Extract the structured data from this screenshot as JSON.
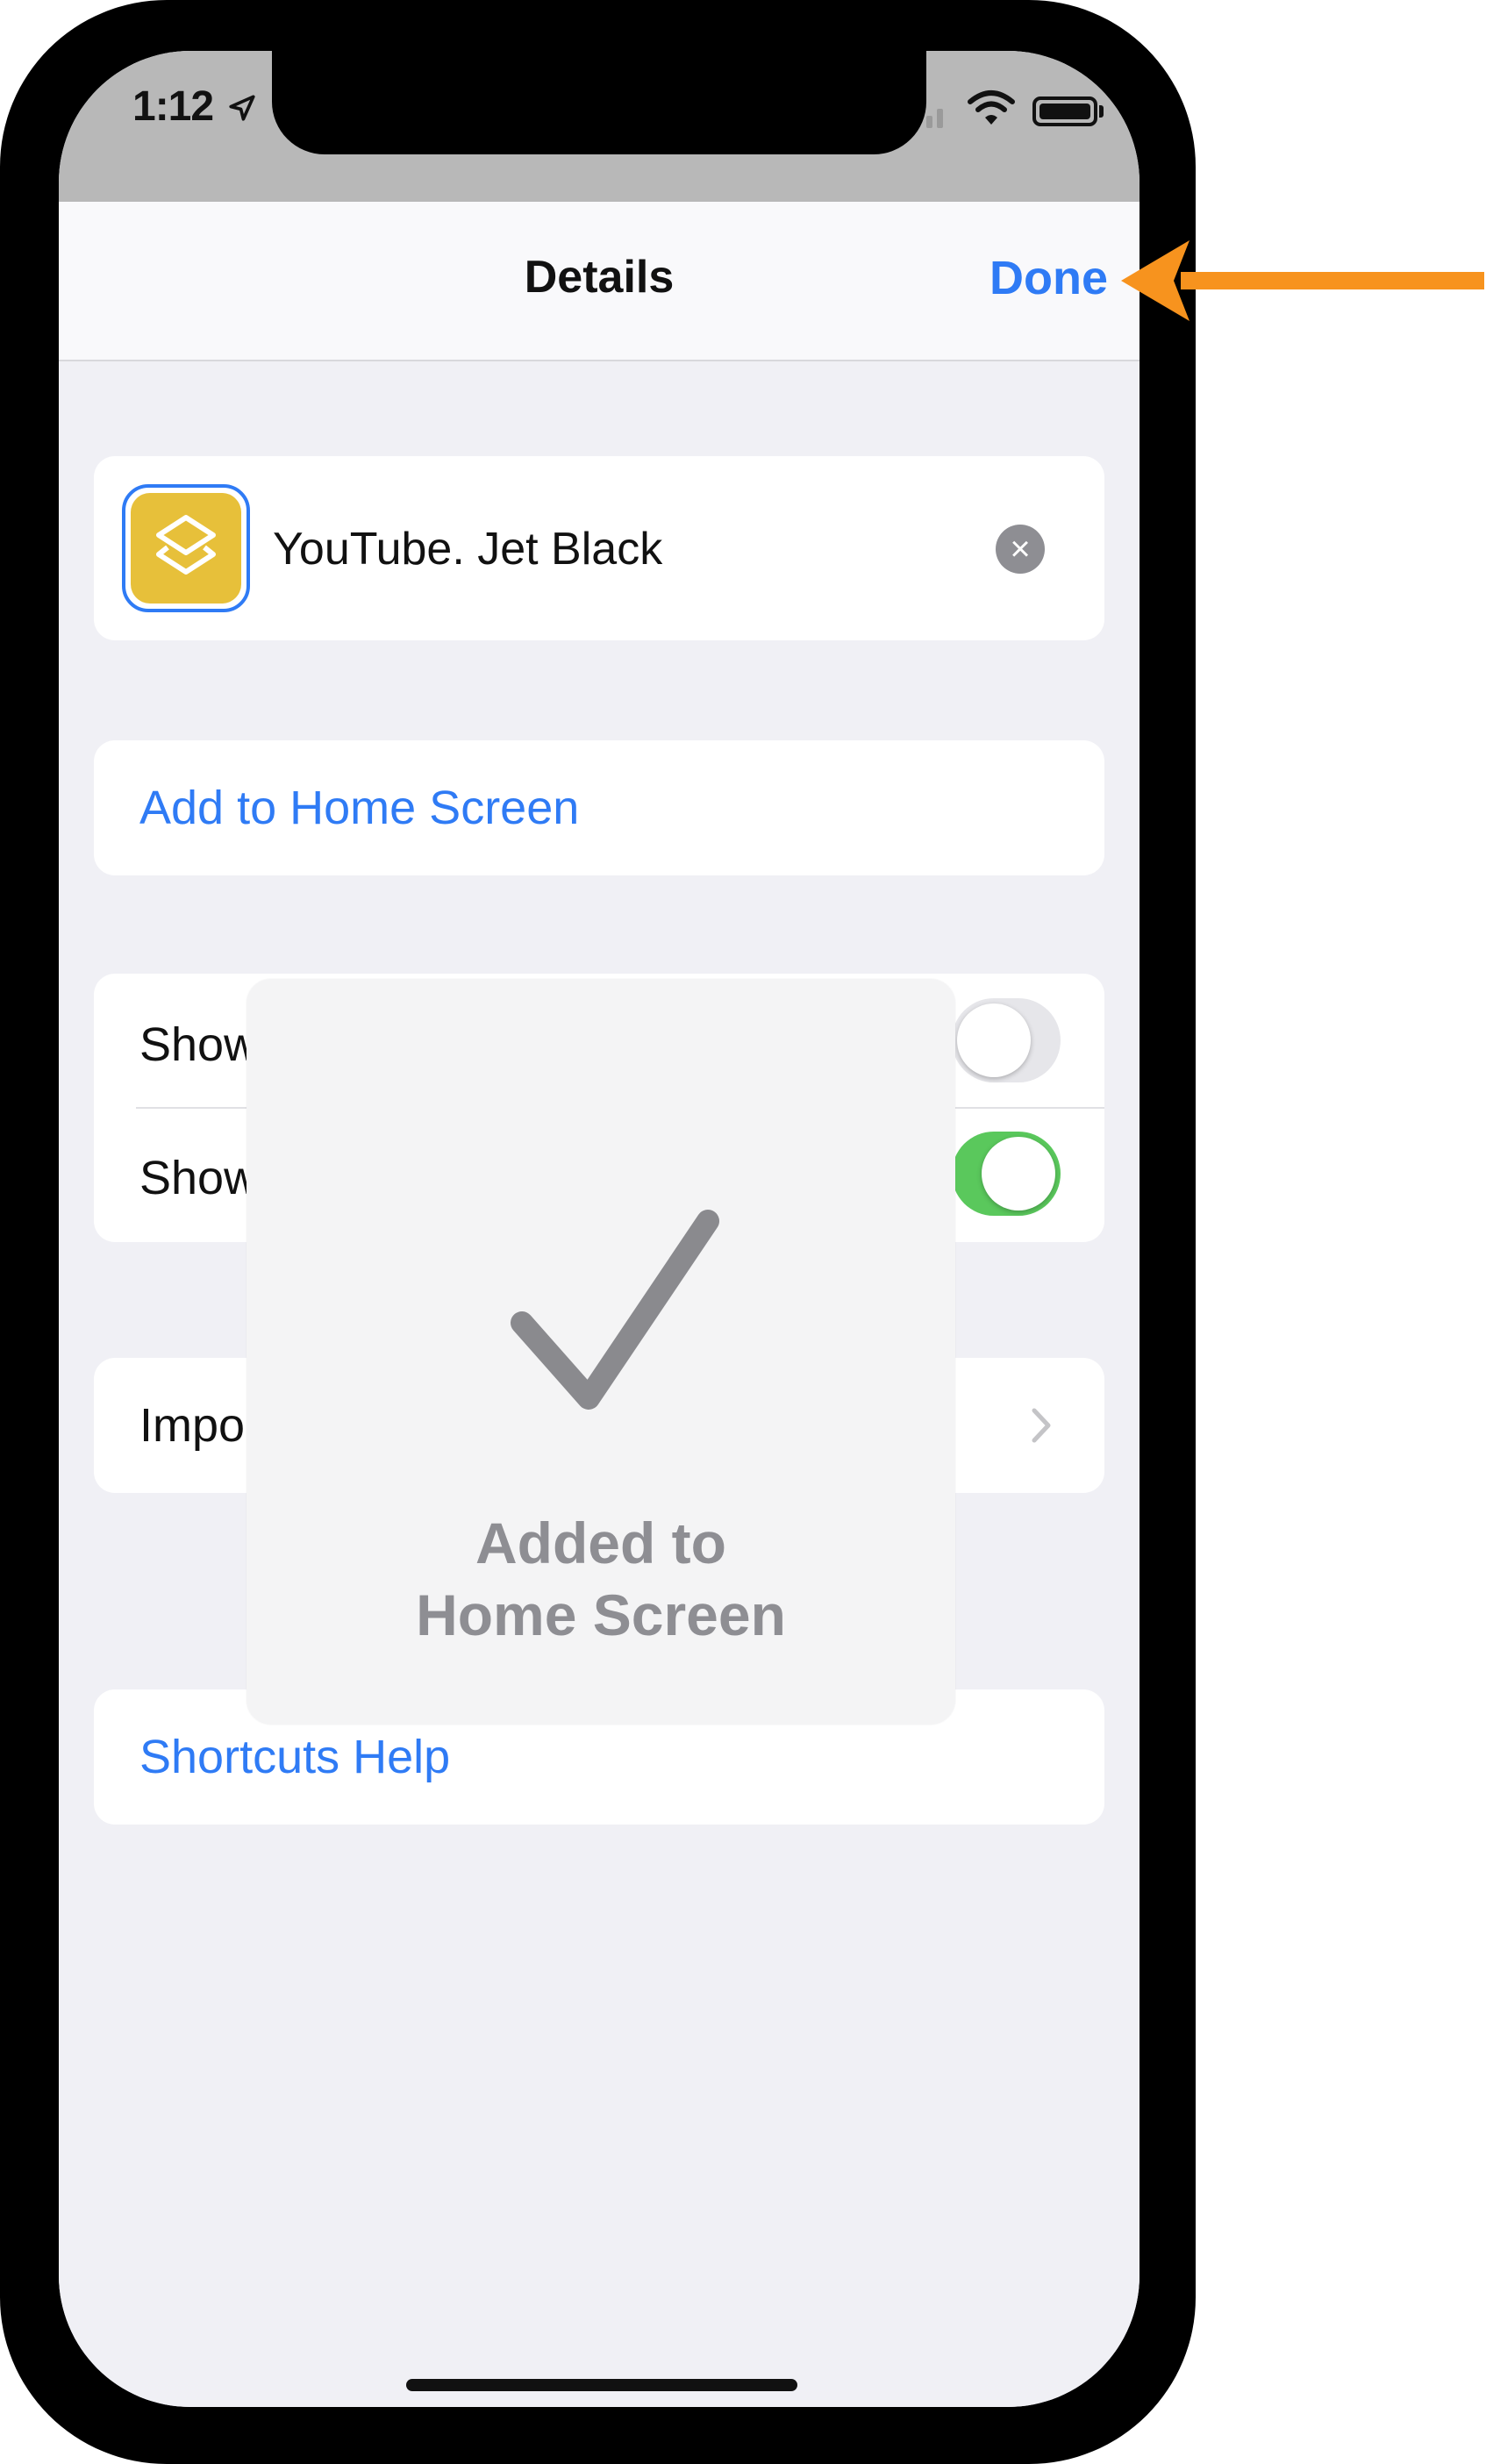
{
  "status_bar": {
    "time": "1:12"
  },
  "navbar": {
    "title": "Details",
    "done_label": "Done"
  },
  "shortcut": {
    "name": "YouTube. Jet Black",
    "icon": "shortcuts-layers-icon",
    "icon_color": "#e7c03a"
  },
  "actions": {
    "add_to_home": "Add to Home Screen",
    "toggle_rows": [
      {
        "label": "Show",
        "state": "off"
      },
      {
        "label": "Show",
        "state": "on"
      }
    ],
    "import_label": "Impo",
    "help": "Shortcuts Help"
  },
  "hud": {
    "line1": "Added to",
    "line2": "Home Screen"
  },
  "colors": {
    "accent": "#2f7bf5",
    "toggle_on": "#5ac85c",
    "annotation_arrow": "#f7931e"
  }
}
